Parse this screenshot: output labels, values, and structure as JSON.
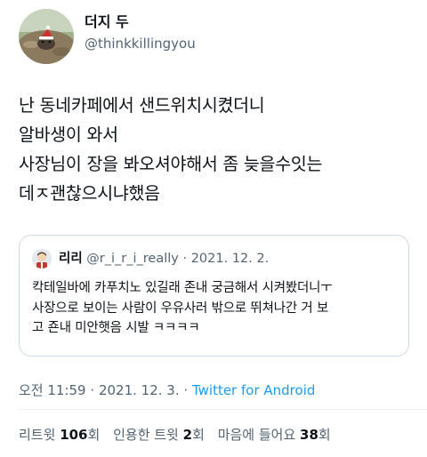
{
  "author": {
    "display_name": "더지 두",
    "handle": "@thinkkillingyou"
  },
  "tweet": {
    "text": "난 동네카페에서 샌드위치시켰더니\n알바생이 와서\n사장님이 장을 봐오셔야해서 좀 늦을수잇는\n데ㅈ괜찮으시냐했음"
  },
  "quoted_tweet": {
    "display_name": "리리",
    "handle": "@r_i_r_i_really",
    "separator": "·",
    "date": "2021. 12. 2.",
    "text": "칵테일바에 카푸치노 있길래 존내 궁금해서 시켜봤더니ㅜ\n사장으로 보이는 사람이 우유사러 밖으로 뛰쳐나간 거 보\n고 죤내 미안햇음 시발 ㅋㅋㅋㅋ"
  },
  "meta": {
    "time": "오전 11:59",
    "separator1": "·",
    "date": "2021. 12. 3.",
    "separator2": "·",
    "source": "Twitter for Android"
  },
  "stats": {
    "retweets_label": "리트윗",
    "retweets": "106",
    "retweets_suffix": "회",
    "quotes_label": "인용한 트윗",
    "quotes": "2",
    "quotes_suffix": "회",
    "likes_label": "마음에 들어요",
    "likes": "38",
    "likes_suffix": "회"
  },
  "colors": {
    "link": "#1d9bf0",
    "secondary_text": "#536471",
    "border": "#cfd9de"
  }
}
